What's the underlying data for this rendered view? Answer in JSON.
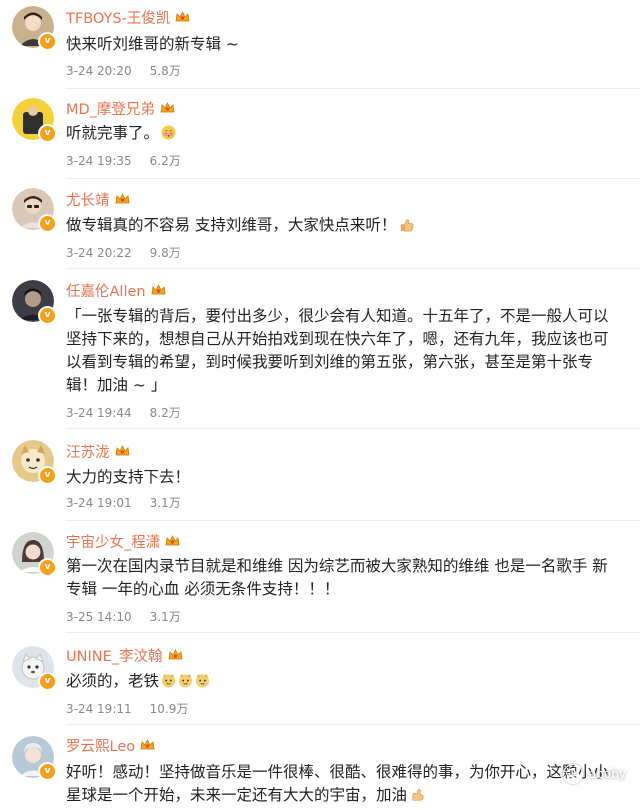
{
  "comments": [
    {
      "username": "TFBOYS-王俊凯",
      "text": "快来听刘维哥的新专辑 ~",
      "time": "3-24 20:20",
      "views": "5.8万",
      "avatar_color": "#c9b18e",
      "avatar_icon": "avatar-photo"
    },
    {
      "username": "MD_摩登兄弟",
      "text": "听就完事了。",
      "time": "3-24 19:35",
      "views": "6.2万",
      "avatar_color": "#f2d23a",
      "avatar_icon": "avatar-photo",
      "trailing_icon": "blush-emoji-icon"
    },
    {
      "username": "尤长靖",
      "text": "做专辑真的不容易 支持刘维哥，大家快点来听！",
      "time": "3-24 20:22",
      "views": "9.8万",
      "avatar_color": "#d9c7b8",
      "avatar_icon": "avatar-photo",
      "trailing_icon": "thumbs-up-icon"
    },
    {
      "username": "任嘉伦Allen",
      "text": "「一张专辑的背后，要付出多少，很少会有人知道。十五年了，不是一般人可以坚持下来的，想想自己从开始拍戏到现在快六年了，嗯，还有九年，我应该也可以看到专辑的希望，到时候我要听到刘维的第五张，第六张，甚至是第十张专辑！加油 ~ 」",
      "time": "3-24 19:44",
      "views": "8.2万",
      "avatar_color": "#3d3d45",
      "avatar_icon": "avatar-photo"
    },
    {
      "username": "汪苏泷",
      "text": "大力的支持下去！",
      "time": "3-24 19:01",
      "views": "3.1万",
      "avatar_color": "#e6c888",
      "avatar_icon": "avatar-photo"
    },
    {
      "username": "宇宙少女_程潇",
      "text": "第一次在国内录节目就是和维维 因为综艺而被大家熟知的维维 也是一名歌手 新专辑 一年的心血 必须无条件支持！！！",
      "time": "3-25 14:10",
      "views": "3.1万",
      "avatar_color": "#cfd4cf",
      "avatar_icon": "avatar-photo"
    },
    {
      "username": "UNINE_李汶翰",
      "text": "必须的，老铁",
      "time": "3-24 19:11",
      "views": "10.9万",
      "avatar_color": "#dfe4ea",
      "avatar_icon": "avatar-photo",
      "trailing_icon": "doge-emoji-icon"
    },
    {
      "username": "罗云熙Leo",
      "text": "好听！感动！坚持做音乐是一件很棒、很酷、很难得的事，为你开心，这颗小小星球是一个开始，未来一定还有大大的宇宙，加油",
      "avatar_color": "#b7c9d6",
      "avatar_icon": "avatar-photo",
      "trailing_icon": "flexed-arm-icon"
    }
  ],
  "watermark": {
    "text": "ababy",
    "icon": "wechat-icon"
  },
  "colors": {
    "username": "#eb7350",
    "badge": "#f7a01c",
    "text": "#222222",
    "meta": "#888888"
  }
}
